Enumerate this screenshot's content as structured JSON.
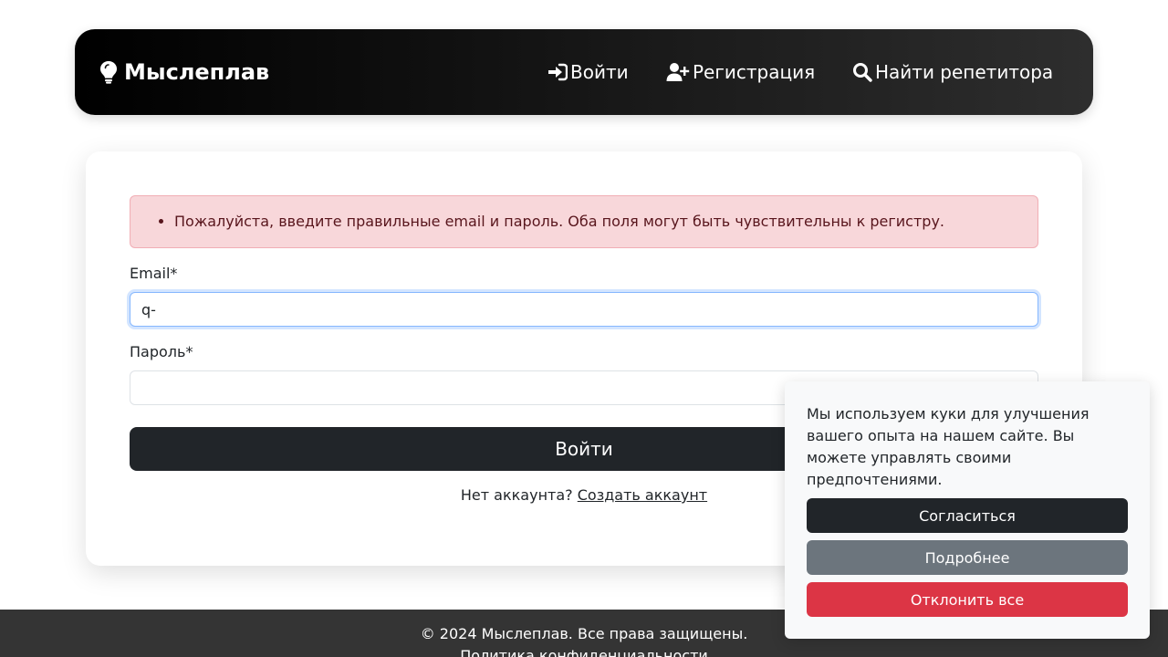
{
  "nav": {
    "brand": "Мыслеплав",
    "links": [
      {
        "label": "Войти",
        "icon": "sign-in-icon"
      },
      {
        "label": "Регистрация",
        "icon": "user-plus-icon"
      },
      {
        "label": "Найти репетитора",
        "icon": "search-icon"
      }
    ]
  },
  "form": {
    "error": "Пожалуйста, введите правильные email и пароль. Оба поля могут быть чувствительны к регистру.",
    "email_label": "Email*",
    "email_value": "q-",
    "password_label": "Пароль*",
    "password_value": "",
    "submit_label": "Войти",
    "no_account_text": "Нет аккаунта?",
    "create_account_link": "Создать аккаунт"
  },
  "footer": {
    "copyright": "© 2024 Мыслеплав. Все права защищены.",
    "privacy_link": "Политика конфиденциальности"
  },
  "cookie": {
    "text": "Мы используем куки для улучшения вашего опыта на нашем сайте. Вы можете управлять своими предпочтениями.",
    "accept": "Согласиться",
    "more": "Подробнее",
    "reject": "Отклонить все"
  },
  "colors": {
    "navbar_gradient_start": "#000000",
    "navbar_gradient_end": "#2e2e2e",
    "alert_bg": "#f8d7da",
    "alert_text": "#58151c",
    "primary_dark": "#212529",
    "secondary": "#6c757d",
    "danger": "#dc3545"
  }
}
